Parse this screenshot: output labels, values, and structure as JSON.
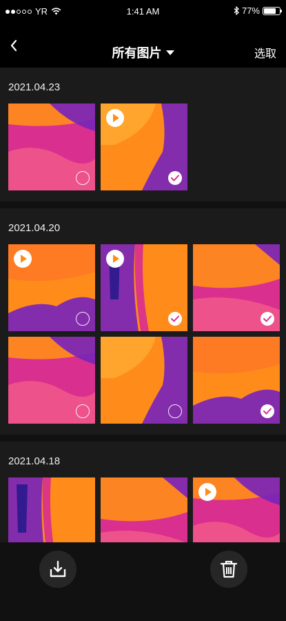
{
  "status_bar": {
    "carrier": "YR",
    "time": "1:41 AM",
    "battery": "77%",
    "battery_level": 0.77,
    "icons": [
      "signal-dots-icon",
      "wifi-icon",
      "bluetooth-icon",
      "battery-icon"
    ]
  },
  "nav": {
    "title": "所有图片",
    "select_label": "选取",
    "icons": [
      "back-chevron-icon",
      "dropdown-caret-icon"
    ]
  },
  "sections": [
    {
      "date": "2021.04.23",
      "items": [
        {
          "video": false,
          "selected": false
        },
        {
          "video": true,
          "selected": true
        }
      ]
    },
    {
      "date": "2021.04.20",
      "items": [
        {
          "video": true,
          "selected": false
        },
        {
          "video": true,
          "selected": true
        },
        {
          "video": false,
          "selected": true
        },
        {
          "video": false,
          "selected": false
        },
        {
          "video": false,
          "selected": false
        },
        {
          "video": false,
          "selected": true
        }
      ]
    },
    {
      "date": "2021.04.18",
      "items": [
        {
          "video": false,
          "selected": false
        },
        {
          "video": false,
          "selected": false
        },
        {
          "video": true,
          "selected": false
        }
      ]
    }
  ],
  "bottom_bar": {
    "icons": [
      "download-icon",
      "trash-icon"
    ]
  },
  "colors": {
    "background": "#111111",
    "section_background": "#1b1b1b",
    "thermal_magenta": "#d92f8f",
    "thermal_orange": "#ff8c1a",
    "thermal_purple": "#7a25b8"
  }
}
